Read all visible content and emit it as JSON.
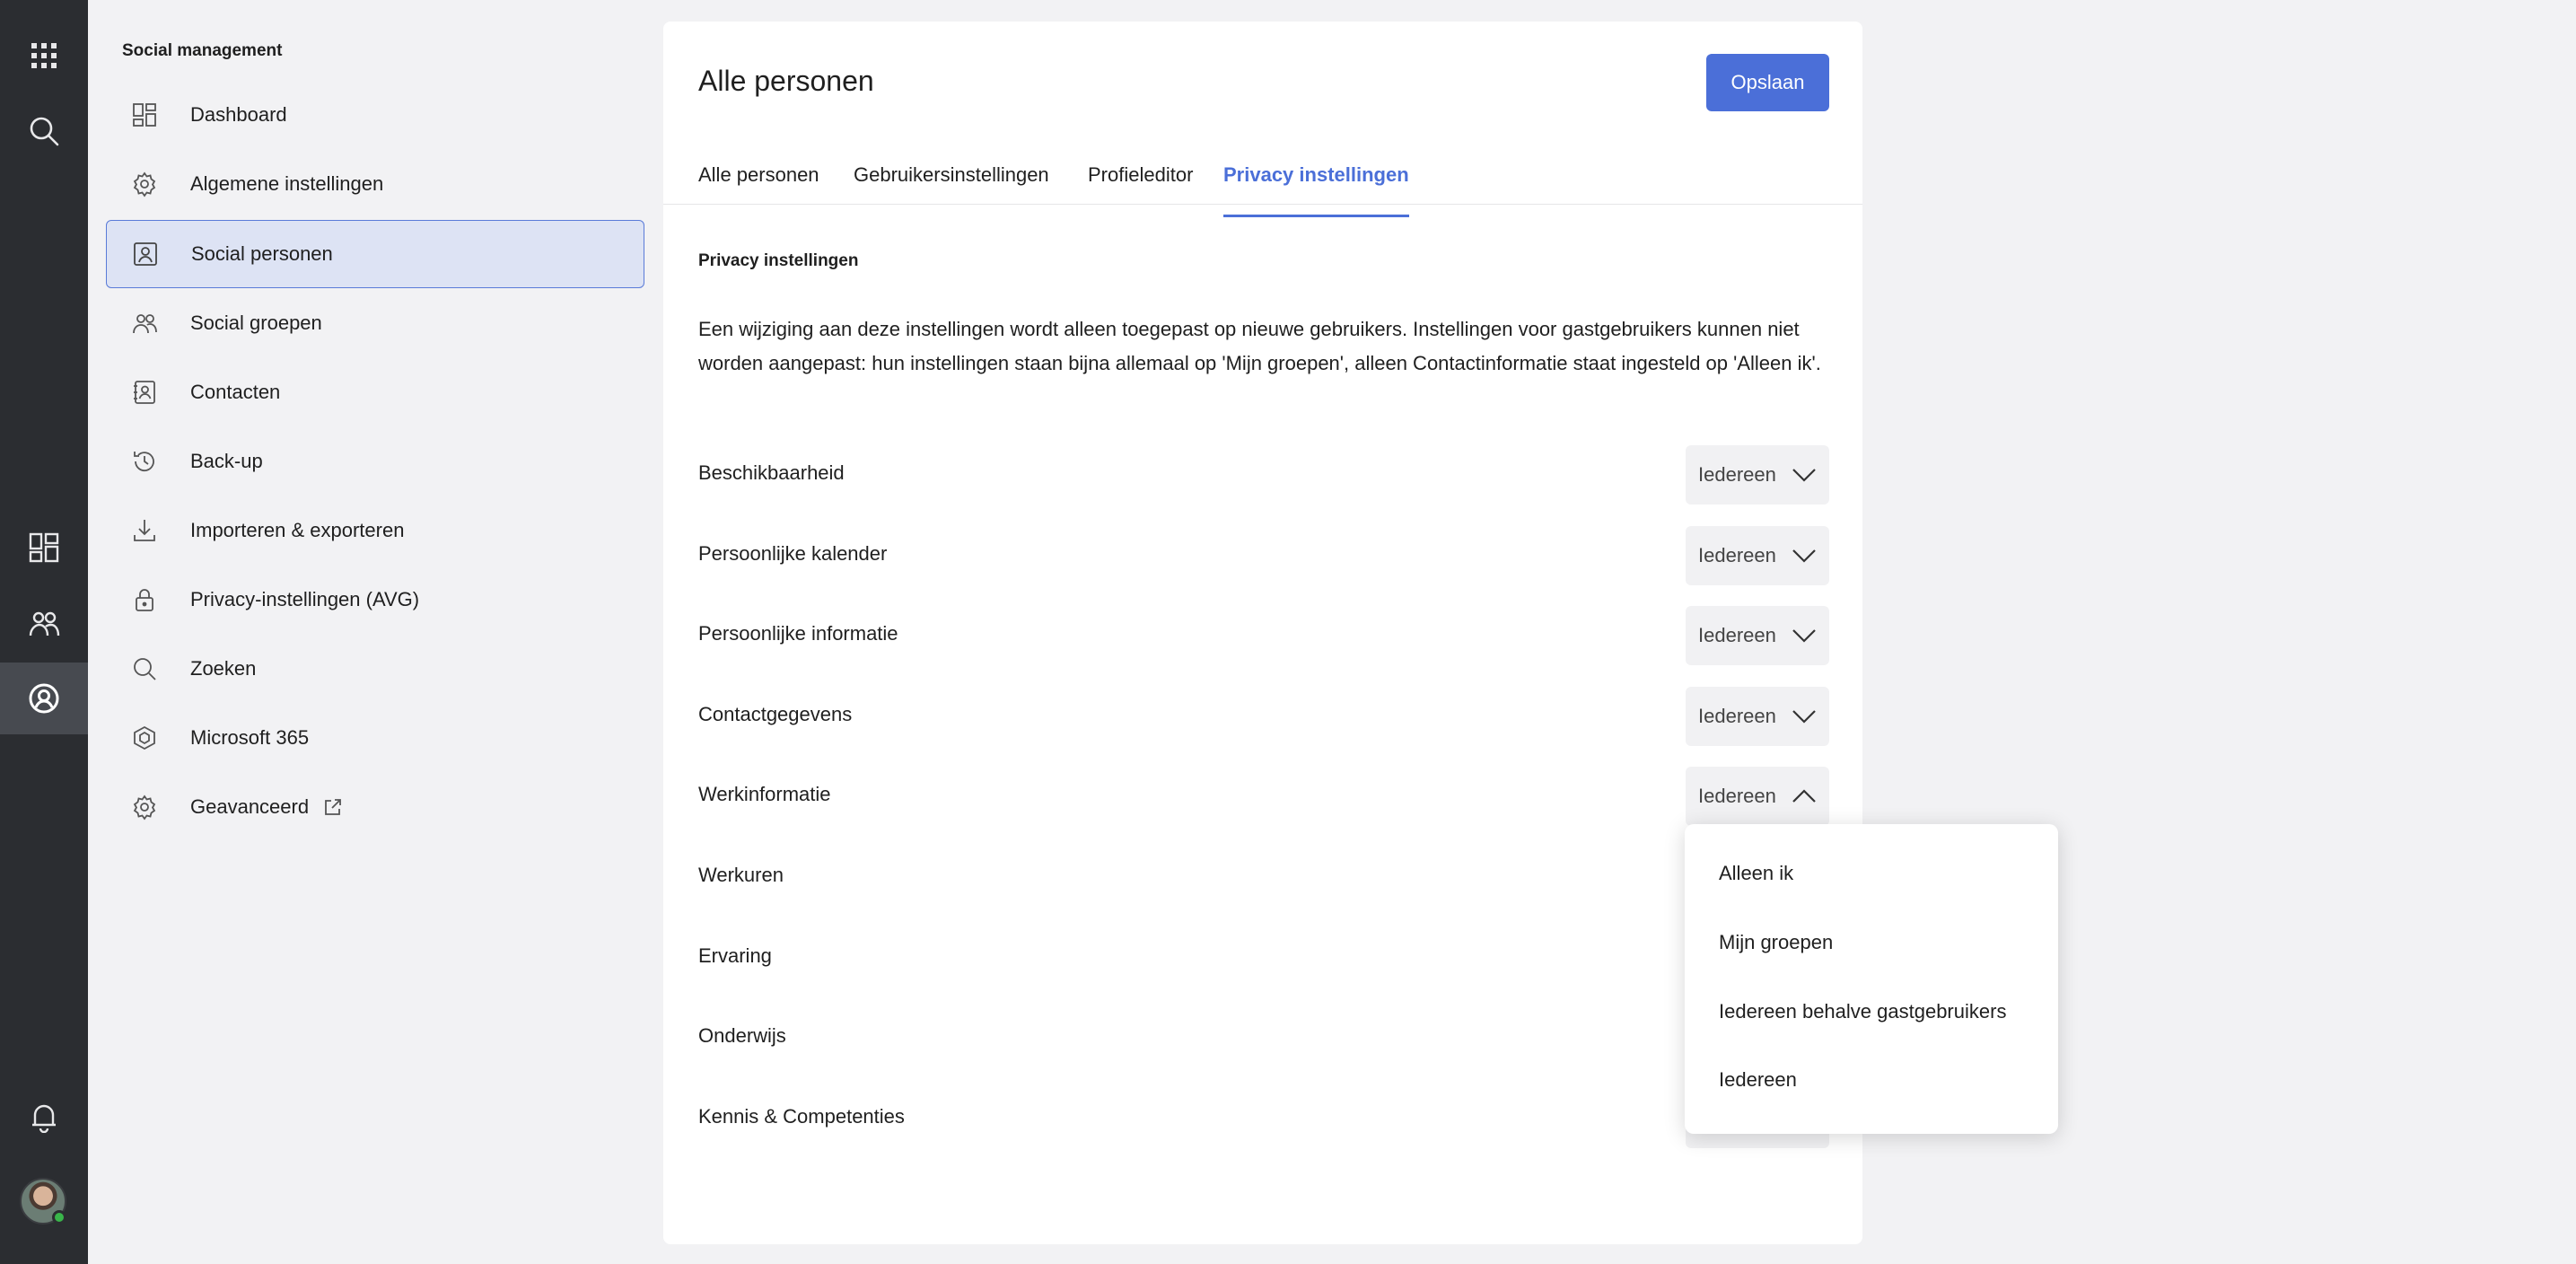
{
  "sidebar": {
    "title": "Social management",
    "items": [
      {
        "label": "Dashboard",
        "icon": "dashboard-icon"
      },
      {
        "label": "Algemene instellingen",
        "icon": "gear-icon"
      },
      {
        "label": "Social personen",
        "icon": "person-card-icon"
      },
      {
        "label": "Social groepen",
        "icon": "people-icon"
      },
      {
        "label": "Contacten",
        "icon": "contacts-icon"
      },
      {
        "label": "Back-up",
        "icon": "history-icon"
      },
      {
        "label": "Importeren & exporteren",
        "icon": "download-icon"
      },
      {
        "label": "Privacy-instellingen (AVG)",
        "icon": "lock-icon"
      },
      {
        "label": "Zoeken",
        "icon": "search-icon"
      },
      {
        "label": "Microsoft 365",
        "icon": "microsoft365-icon"
      },
      {
        "label": "Geavanceerd",
        "icon": "gear-icon"
      }
    ],
    "active_index": 2
  },
  "header": {
    "title": "Alle personen",
    "save_label": "Opslaan"
  },
  "tabs": [
    {
      "label": "Alle personen"
    },
    {
      "label": "Gebruikersinstellingen"
    },
    {
      "label": "Profieleditor"
    },
    {
      "label": "Privacy instellingen"
    }
  ],
  "active_tab": 3,
  "main": {
    "section_title": "Privacy instellingen",
    "description": "Een wijziging aan deze instellingen wordt alleen toegepast op nieuwe gebruikers. Instellingen voor gastgebruikers kunnen niet worden aangepast: hun instellingen staan bijna allemaal op 'Mijn groepen', alleen Contactinformatie staat ingesteld op 'Alleen ik'.",
    "rows": [
      {
        "label": "Beschikbaarheid",
        "value": "Iedereen"
      },
      {
        "label": "Persoonlijke kalender",
        "value": "Iedereen"
      },
      {
        "label": "Persoonlijke informatie",
        "value": "Iedereen"
      },
      {
        "label": "Contactgegevens",
        "value": "Iedereen"
      },
      {
        "label": "Werkinformatie",
        "value": "Iedereen"
      },
      {
        "label": "Werkuren",
        "value": ""
      },
      {
        "label": "Ervaring",
        "value": ""
      },
      {
        "label": "Onderwijs",
        "value": ""
      },
      {
        "label": "Kennis & Competenties",
        "value": ""
      }
    ]
  },
  "dropdown": {
    "options": [
      "Alleen ik",
      "Mijn groepen",
      "Iedereen behalve gastgebruikers",
      "Iedereen"
    ]
  },
  "colors": {
    "accent": "#4b6fd8",
    "rail_bg": "#2b2d31",
    "active_nav_bg": "#dde3f4"
  }
}
